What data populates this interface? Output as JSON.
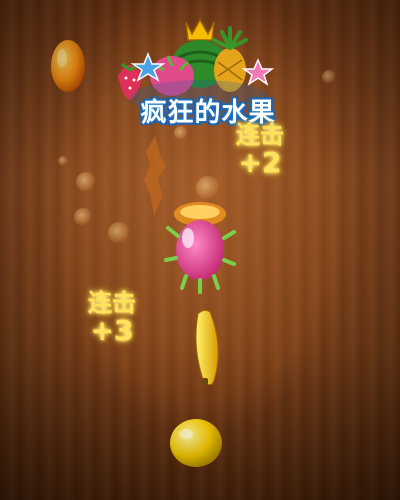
{
  "game": {
    "logo_title": "疯狂的水果",
    "combos": [
      {
        "label": "连击",
        "value": "+2"
      },
      {
        "label": "连击",
        "value": "+3"
      }
    ]
  },
  "colors": {
    "combo_text": "#ffe25a",
    "logo_outline": "#1c5fa8",
    "wood_dark": "#4e250c",
    "wood_light": "#8a4a20"
  },
  "icons": [
    "crown-icon",
    "watermelon-icon",
    "pineapple-icon",
    "strawberry-icon",
    "dragon-fruit-icon",
    "star-icon",
    "mango-icon",
    "banana-icon",
    "lemon-icon"
  ]
}
